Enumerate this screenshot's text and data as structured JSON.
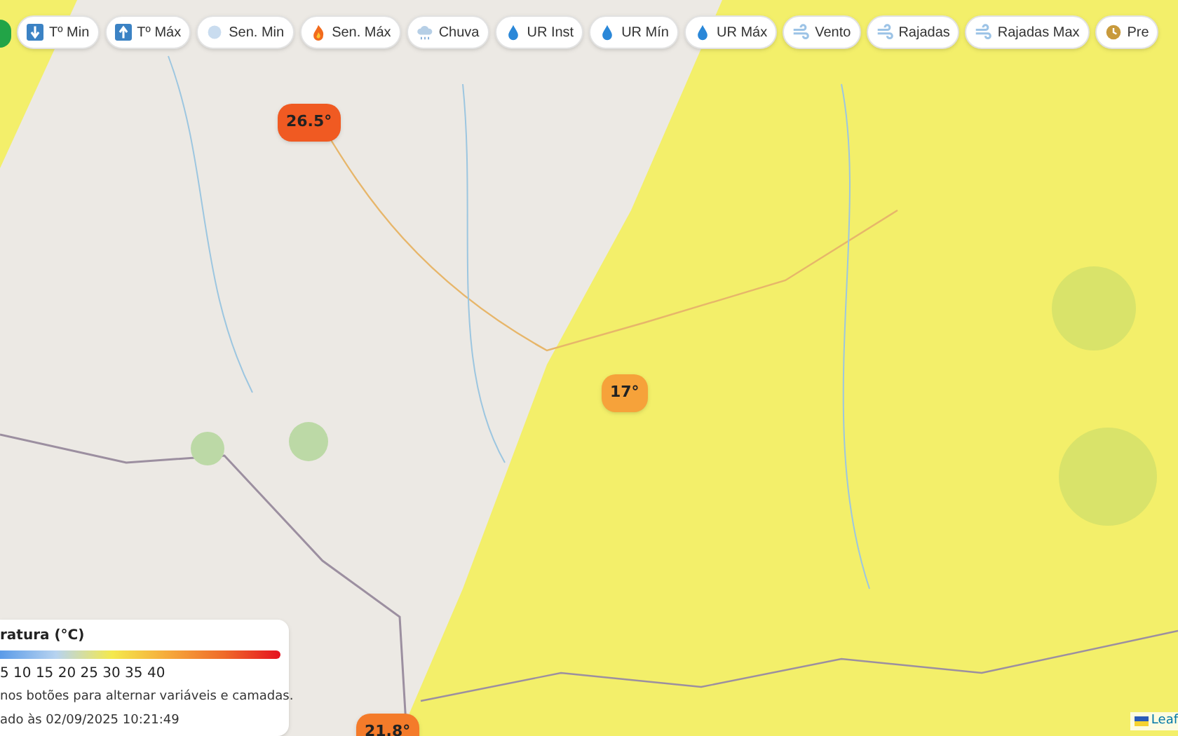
{
  "toolbar": {
    "buttons": [
      {
        "label": "Tº Min",
        "kind": "arrow-down"
      },
      {
        "label": "Tº Máx",
        "kind": "arrow-up"
      },
      {
        "label": "Sen. Min",
        "kind": "snow"
      },
      {
        "label": "Sen. Máx",
        "kind": "fire"
      },
      {
        "label": "Chuva",
        "kind": "rain"
      },
      {
        "label": "UR Inst",
        "kind": "drop"
      },
      {
        "label": "UR Mín",
        "kind": "drop"
      },
      {
        "label": "UR Máx",
        "kind": "drop"
      },
      {
        "label": "Vento",
        "kind": "wind"
      },
      {
        "label": "Rajadas",
        "kind": "wind"
      },
      {
        "label": "Rajadas Max",
        "kind": "wind"
      },
      {
        "label": "Pre",
        "kind": "clock"
      }
    ]
  },
  "markers": [
    {
      "value": "26.5°",
      "color": "#f05a22"
    },
    {
      "value": "17°",
      "color": "#f6a23a"
    },
    {
      "value": "21.8°",
      "color": "#f47b2a"
    }
  ],
  "legend": {
    "title": "ratura (°C)",
    "scale": "5 10 15 20 25 30 35 40",
    "hint": "nos botões para alternar variáveis e camadas.",
    "updated": "ado às 02/09/2025 10:21:49"
  },
  "attribution": "Leaf"
}
